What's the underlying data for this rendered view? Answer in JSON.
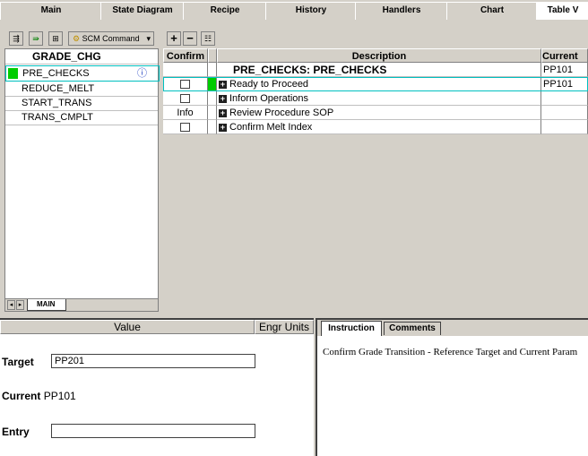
{
  "tabs": [
    {
      "label": "Main"
    },
    {
      "label": "State Diagram"
    },
    {
      "label": "Recipe"
    },
    {
      "label": "History"
    },
    {
      "label": "Handlers"
    },
    {
      "label": "Chart"
    },
    {
      "label": "Table V"
    }
  ],
  "toolbar": {
    "scm_command_label": "SCM Command"
  },
  "table_toolbar": {
    "add_label": "+",
    "remove_label": "−"
  },
  "left_list": {
    "header": "GRADE_CHG",
    "items": [
      {
        "label": "PRE_CHECKS"
      },
      {
        "label": "REDUCE_MELT"
      },
      {
        "label": "START_TRANS"
      },
      {
        "label": "TRANS_CMPLT"
      }
    ],
    "sheet_tab": "MAIN"
  },
  "table": {
    "headers": {
      "confirm": "Confirm",
      "description": "Description",
      "current": "Current"
    },
    "title_row": {
      "description": "PRE_CHECKS: PRE_CHECKS",
      "current": "PP101"
    },
    "rows": [
      {
        "confirm": "",
        "description": "Ready to Proceed",
        "current": "PP101"
      },
      {
        "confirm": "",
        "description": "Inform Operations",
        "current": ""
      },
      {
        "confirm": "Info",
        "description": "Review Procedure SOP",
        "current": ""
      },
      {
        "confirm": "",
        "description": "Confirm Melt Index",
        "current": ""
      }
    ]
  },
  "bottom_left": {
    "value_header": "Value",
    "units_header": "Engr Units",
    "target_label": "Target",
    "target_value": "PP201",
    "current_label": "Current",
    "current_value": "PP101",
    "entry_label": "Entry",
    "entry_value": ""
  },
  "bottom_right": {
    "tabs": [
      {
        "label": "Instruction"
      },
      {
        "label": "Comments"
      }
    ],
    "instruction_text": "Confirm Grade Transition  - Reference Target and Current Param"
  },
  "colors": {
    "accent": "#00cc00",
    "selection": "#00c0c0"
  }
}
